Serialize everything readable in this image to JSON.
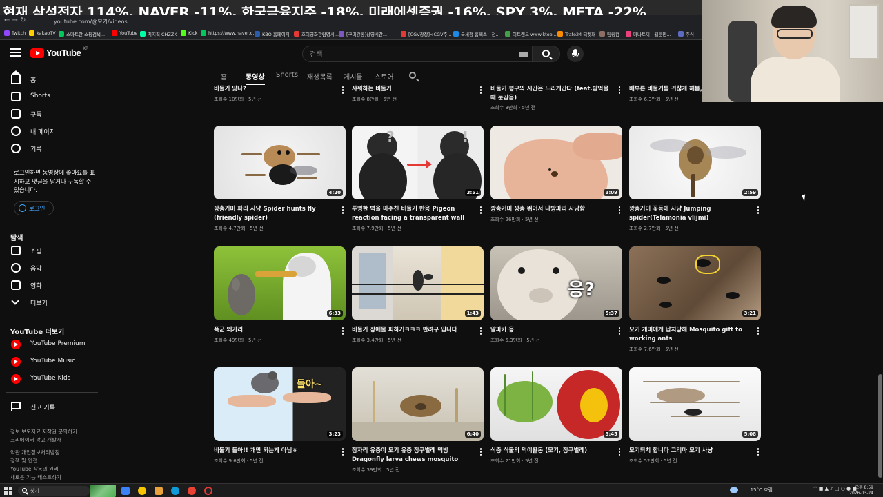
{
  "overlay": {
    "caption": "현재 삼성전자 114%, NAVER -11%, 한국금융지주 -18%, 미래에셋증권 -16%, SPY 3%, META -22%"
  },
  "browser": {
    "url": "youtube.com/@모기/videos",
    "bookmarks": [
      {
        "label": "Twitch",
        "color": "#9146ff"
      },
      {
        "label": "kakaoTV",
        "color": "#ffcd00"
      },
      {
        "label": "스마트한 쇼핑검색...",
        "color": "#03c75a"
      },
      {
        "label": "YouTube",
        "color": "#ff0000"
      },
      {
        "label": "치지직 CHZZK",
        "color": "#00ffa3"
      },
      {
        "label": "Kick",
        "color": "#53fc18"
      },
      {
        "label": "https://www.naver.c...",
        "color": "#03c75a"
      },
      {
        "label": "KBO 홈페이지",
        "color": "#2a5caa"
      },
      {
        "label": "호이영화관람명시...",
        "color": "#e53935"
      },
      {
        "label": "[구미강동]상영시간...",
        "color": "#7e57c2"
      },
      {
        "label": "[CGV광장]<CGV주...",
        "color": "#e53935"
      },
      {
        "label": "국세청 홈택스 - 전...",
        "color": "#1e88e5"
      },
      {
        "label": "이트랜드 www.ktoo...",
        "color": "#43a047"
      },
      {
        "label": "Trafe24 티켓패",
        "color": "#fb8c00"
      },
      {
        "label": "팀링컴",
        "color": "#8d6e63"
      },
      {
        "label": "마나토끼 - 웹툰만...",
        "color": "#ec407a"
      },
      {
        "label": "주식",
        "color": "#5c6bc0"
      }
    ]
  },
  "masthead": {
    "logo_text": "YouTube",
    "logo_region": "KR",
    "search_placeholder": "검색"
  },
  "sidebar": {
    "main": [
      {
        "label": "홈",
        "icon": "home-icon"
      },
      {
        "label": "Shorts",
        "icon": "shorts-icon"
      },
      {
        "label": "구독",
        "icon": "subscriptions-icon"
      },
      {
        "label": "내 페이지",
        "icon": "user-icon"
      },
      {
        "label": "기록",
        "icon": "history-icon"
      }
    ],
    "signin_prompt": "로그인하면 동영상에 좋아요를 표시하고 댓글을 달거나 구독할 수 있습니다.",
    "login_label": "로그인",
    "explore_heading": "탐색",
    "explore": [
      {
        "label": "쇼핑",
        "icon": "shopping-icon"
      },
      {
        "label": "음악",
        "icon": "music-icon"
      },
      {
        "label": "영화",
        "icon": "movie-icon"
      },
      {
        "label": "더보기",
        "icon": "chevron-down-icon"
      }
    ],
    "more_heading": "YouTube 더보기",
    "more": [
      {
        "label": "YouTube Premium"
      },
      {
        "label": "YouTube Music"
      },
      {
        "label": "YouTube Kids"
      }
    ],
    "report_label": "신고 기록",
    "footer": [
      "정보  보도자료  저작권  문의하기",
      "크리에이터  광고  개발자",
      "약관  개인정보처리방침",
      "정책 및 안전",
      "YouTube 작동의 원리",
      "새로운 기능 테스트하기"
    ]
  },
  "tabs": [
    {
      "label": "홈"
    },
    {
      "label": "동영상",
      "active": true
    },
    {
      "label": "Shorts"
    },
    {
      "label": "재생목록"
    },
    {
      "label": "게시물"
    },
    {
      "label": "스토어"
    }
  ],
  "partial_row": [
    {
      "title": "비둘기 맞나?",
      "meta": "조회수 10만회 · 5년 전"
    },
    {
      "title": "샤워하는 비둘기",
      "meta": "조회수 8만회 · 5년 전"
    },
    {
      "title": "비둘기 평구의 시간은 느리게간다 (feat.밤먹물때 눈감음)",
      "meta": "조회수 3만회 · 5년 전"
    },
    {
      "title": "배부른 비둘기를 귀찮게 해봄,",
      "meta": "조회수 6.3만회 · 5년 전"
    }
  ],
  "videos": [
    {
      "title": "깡충거미 파리 사냥 Spider hunts fly (friendly spider)",
      "meta": "조회수 4.7만회 · 5년 전",
      "duration": "4:20"
    },
    {
      "title": "투명한 벽을 마주친 비둘기 반응 Pigeon reaction facing a transparent wall",
      "meta": "조회수 7.9만회 · 5년 전",
      "duration": "3:51"
    },
    {
      "title": "깡충거미 깡충 뛰어서 나방파리 사냥함",
      "meta": "조회수 26만회 · 5년 전",
      "duration": "3:09"
    },
    {
      "title": "깡충거미 꽃등에 사냥 Jumping spider(Telamonia vlijmi)",
      "meta": "조회수 2.7만회 · 5년 전",
      "duration": "2:59"
    },
    {
      "title": "폭군 왜가리",
      "meta": "조회수 49만회 · 5년 전",
      "duration": "6:33"
    },
    {
      "title": "비둘기 장애물 피하기ㅋㅋㅋ 반려구 입니다",
      "meta": "조회수 3.4만회 · 5년 전",
      "duration": "1:43"
    },
    {
      "title": "알파카 응",
      "meta": "조회수 5.3만회 · 5년 전",
      "duration": "5:37"
    },
    {
      "title": "모기 개미에게 납치당해 Mosquito gift to working ants",
      "meta": "조회수 7.6만회 · 5년 전",
      "duration": "3:21"
    },
    {
      "title": "비둘기 돌아!! 개만 되는게 아님ㅎ",
      "meta": "조회수 9.6만회 · 5년 전",
      "duration": "3:23"
    },
    {
      "title": "잠자리 유충이 모기 유충 장구벌레 먹방 Dragonfly larva chews mosquito larva",
      "meta": "조회수 39만회 · 5년 전",
      "duration": "6:40"
    },
    {
      "title": "식충 식물의 먹이활동 (모기, 장구벌레)",
      "meta": "조회수 21만회 · 5년 전",
      "duration": "3:45"
    },
    {
      "title": "모기퇴치 합니다 그리마 모기 사냥",
      "meta": "조회수 52만회 · 5년 전",
      "duration": "5:08"
    }
  ],
  "thumb_text": {
    "alpaca": "응?",
    "pigeon_hand": "돌아~",
    "pigeon_q": "?",
    "pigeon_ex": "!"
  },
  "taskbar": {
    "search_label": "찾기",
    "weather": "15°C 흐림",
    "clock_time": "오후 8:59",
    "clock_date": "2026-03-24"
  }
}
